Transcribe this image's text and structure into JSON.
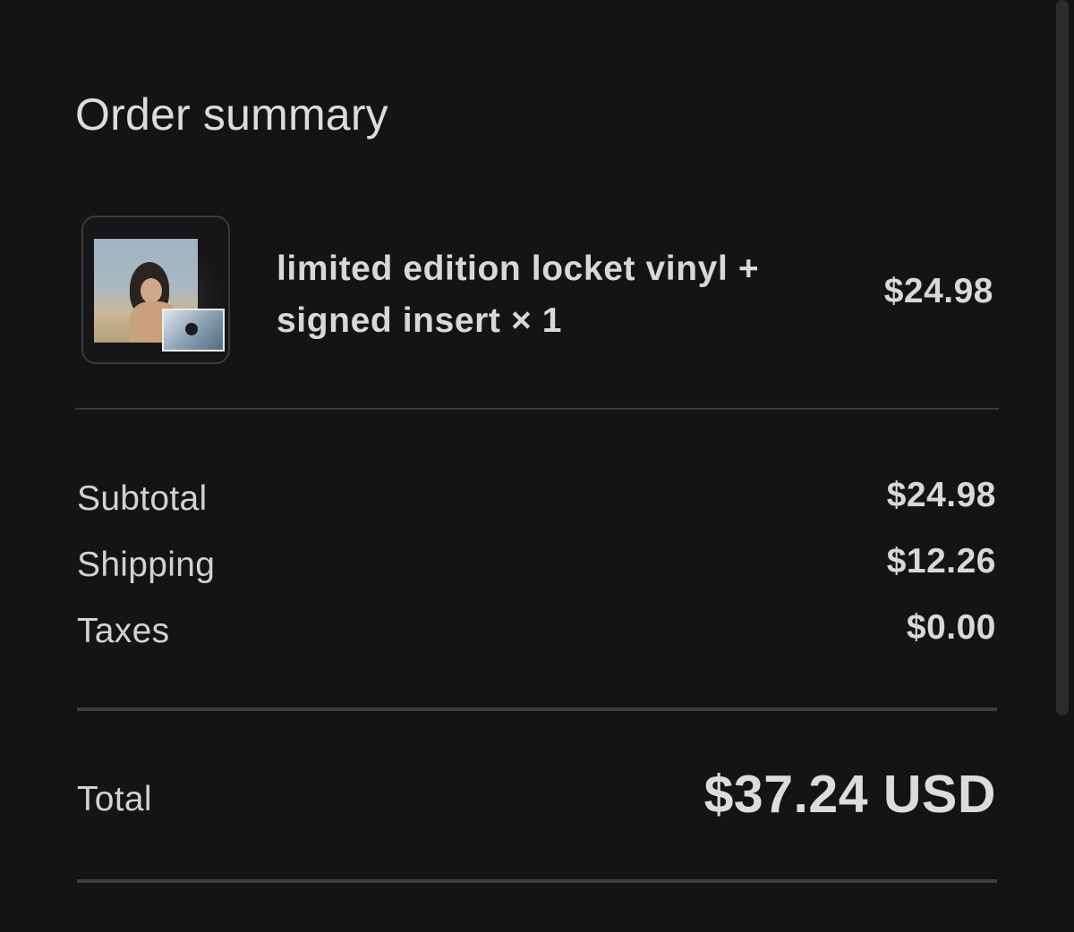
{
  "order_summary": {
    "title": "Order summary",
    "item": {
      "name_line1": "limited edition locket vinyl +",
      "name_line2": "signed insert × 1",
      "price": "$24.98"
    },
    "subtotal": {
      "label": "Subtotal",
      "value": "$24.98"
    },
    "shipping": {
      "label": "Shipping",
      "value": "$12.26"
    },
    "taxes": {
      "label": "Taxes",
      "value": "$0.00"
    },
    "total": {
      "label": "Total",
      "value": "$37.24 USD"
    }
  },
  "colors": {
    "background": "#141416",
    "text": "#d6d6d8",
    "divider": "#3a3a3d"
  }
}
